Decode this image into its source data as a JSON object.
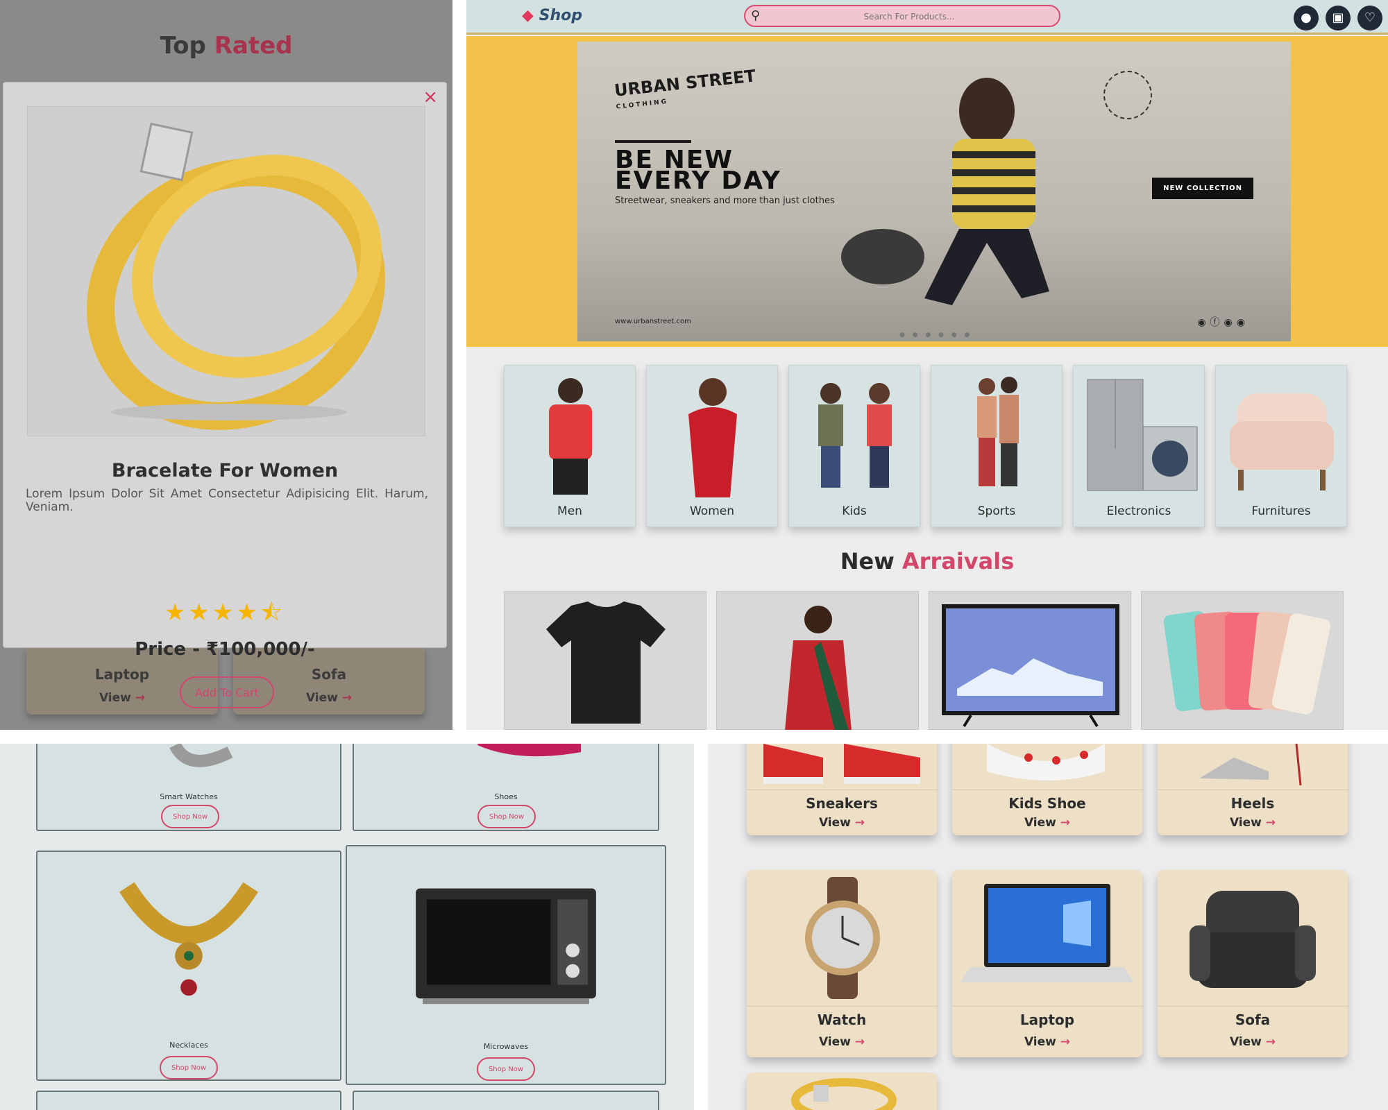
{
  "panel_modal": {
    "section_title_a": "Top",
    "section_title_b": "Rated",
    "close_icon": "×",
    "product_title": "Bracelate For Women",
    "product_desc": "Lorem Ipsum Dolor Sit Amet Consectetur Adipisicing Elit. Harum, Veniam.",
    "rating": 4.5,
    "stars_text": "★★★★⯪",
    "price": "Price - ₹100,000/-",
    "cart_button": "Add To Cart",
    "bg_cards": [
      {
        "name": "Laptop",
        "view": "View"
      },
      {
        "name": "Sofa",
        "view": "View"
      }
    ],
    "arrow": "→"
  },
  "header": {
    "logo_text": "Shop",
    "logo_icon": "tag-icon",
    "search_placeholder": "Search For Products...",
    "icons": [
      "user-icon",
      "bag-icon",
      "heart-icon"
    ],
    "icon_glyphs": [
      "●",
      "▣",
      "♡"
    ]
  },
  "hero": {
    "brand": "URBAN STREET",
    "brand_sub": "CLOTHING",
    "headline_1": "BE NEW",
    "headline_2": "EVERY DAY",
    "subtext": "Streetwear, sneakers and more than just clothes",
    "badge": "NEW COLLECTION",
    "url": "www.urbanstreet.com",
    "socials": "◉ⓕ◉◉",
    "dots": "● ● ● ● ● ●"
  },
  "categories": [
    "Men",
    "Women",
    "Kids",
    "Sports",
    "Electronics",
    "Furnitures"
  ],
  "new_arrivals": {
    "title_a": "New",
    "title_b": "Arraivals"
  },
  "shop_now": {
    "items": [
      {
        "name": "Smart Watches",
        "button": "Shop Now"
      },
      {
        "name": "Shoes",
        "button": "Shop Now"
      },
      {
        "name": "Necklaces",
        "button": "Shop Now"
      },
      {
        "name": "Microwaves",
        "button": "Shop Now"
      }
    ]
  },
  "view_cards": {
    "items": [
      {
        "name": "Sneakers",
        "view": "View"
      },
      {
        "name": "Kids Shoe",
        "view": "View"
      },
      {
        "name": "Heels",
        "view": "View"
      },
      {
        "name": "Watch",
        "view": "View"
      },
      {
        "name": "Laptop",
        "view": "View"
      },
      {
        "name": "Sofa",
        "view": "View"
      }
    ],
    "arrow": "→"
  },
  "colors": {
    "accent": "#d2476a",
    "header_bg": "#d4e1e1",
    "hero_bg": "#f2c24a",
    "star": "#f4b400",
    "view_card_bg": "#ede0c7"
  }
}
